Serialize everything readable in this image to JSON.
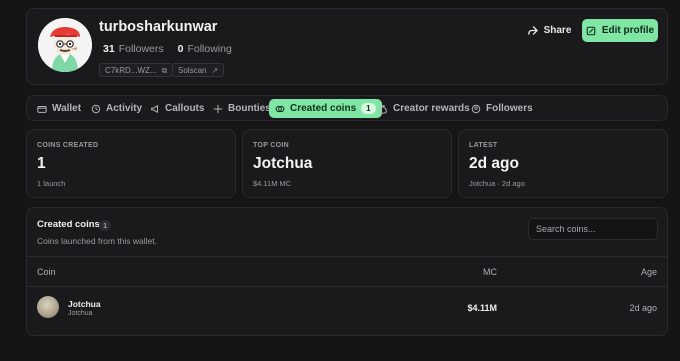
{
  "profile": {
    "username": "turbosharkunwar",
    "followers_count": "31",
    "followers_label": "Followers",
    "following_count": "0",
    "following_label": "Following",
    "wallet_short": "C7kRD...WZ...",
    "solscan_label": "Solscan",
    "share_label": "Share",
    "edit_label": "Edit profile"
  },
  "tabs": [
    {
      "label": "Wallet",
      "icon": "wallet-icon"
    },
    {
      "label": "Activity",
      "icon": "clock-icon"
    },
    {
      "label": "Callouts",
      "icon": "megaphone-icon"
    },
    {
      "label": "Bounties",
      "icon": "sparkle-icon"
    },
    {
      "label": "Created coins",
      "icon": "coins-icon",
      "badge": "1",
      "active": true
    },
    {
      "label": "Creator rewards",
      "icon": "money-bag-icon"
    },
    {
      "label": "Followers",
      "icon": "users-icon"
    }
  ],
  "stats": [
    {
      "label": "COINS CREATED",
      "value": "1",
      "sub": "1 launch"
    },
    {
      "label": "TOP COIN",
      "value": "Jotchua",
      "sub": "$4.11M MC"
    },
    {
      "label": "LATEST",
      "value": "2d ago",
      "sub": "Jotchua · 2d ago"
    }
  ],
  "coins": {
    "title": "Created coins",
    "count": "1",
    "subtitle": "Coins launched from this wallet.",
    "search_placeholder": "Search coins...",
    "headers": {
      "coin": "Coin",
      "mc": "MC",
      "age": "Age"
    },
    "rows": [
      {
        "name": "Jotchua",
        "symbol": "Jotchua",
        "mc": "$4.11M",
        "age": "2d ago"
      }
    ]
  },
  "colors": {
    "accent": "#7fe6a3",
    "background": "#151516",
    "card": "#1a1a1c"
  }
}
